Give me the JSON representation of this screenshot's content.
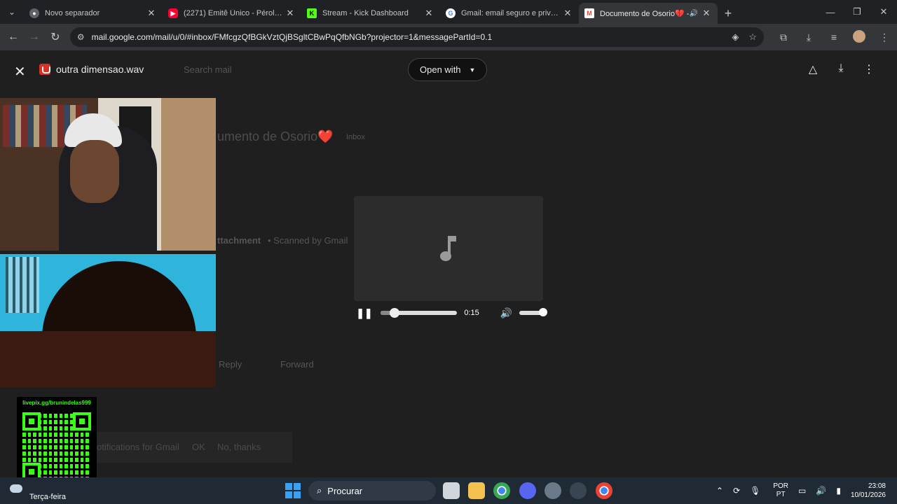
{
  "browser": {
    "tabs": [
      {
        "title": "Novo separador",
        "favicon": "chrome-icon",
        "active": false
      },
      {
        "title": "(2271) Emitê Único - Pérolas (O",
        "favicon": "youtube-icon",
        "active": false
      },
      {
        "title": "Stream - Kick Dashboard",
        "favicon": "kick-icon",
        "active": false
      },
      {
        "title": "Gmail: email seguro e privado",
        "favicon": "google-icon",
        "active": false
      },
      {
        "title": "Documento de Osorio💔 - ",
        "favicon": "gmail-icon",
        "active": true
      }
    ],
    "url": "mail.google.com/mail/u/0/#inbox/FMfcgzQfBGkVztQjBSgltCBwPqQfbNGb?projector=1&messagePartId=0.1"
  },
  "viewer": {
    "file_name": "outra dimensao.wav",
    "open_with_label": "Open with",
    "background": {
      "search_placeholder": "Search mail",
      "subject": "umento de Osorio❤️",
      "inbox_badge": "Inbox",
      "attachment_label": "ttachment",
      "scanned": "• Scanned by Gmail",
      "reply": "Reply",
      "forward": "Forward",
      "toast": "otifications for Gmail",
      "toast_ok": "OK",
      "toast_no": "No, thanks"
    },
    "player": {
      "time": "0:15",
      "progress": 0.18,
      "volume": 1.0
    }
  },
  "qr": {
    "label": "livepix.gg/brunindelas999"
  },
  "taskbar": {
    "weather_text": "Terça-feira",
    "search_label": "Procurar",
    "lang_top": "POR",
    "lang_bottom": "PT",
    "time": "23:08",
    "date": "10/01/2026"
  }
}
